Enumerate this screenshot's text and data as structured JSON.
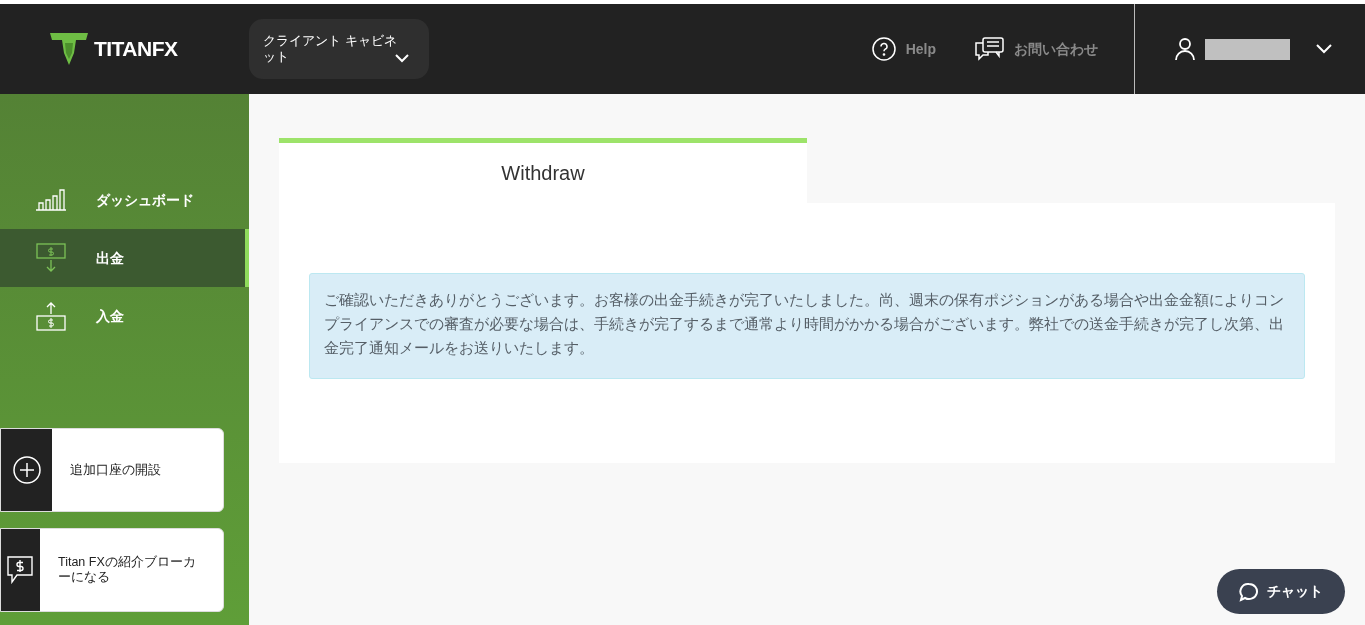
{
  "header": {
    "logo": "TITANFX",
    "cabinet_menu": "クライアント キャビネット",
    "help": "Help",
    "contact": "お問い合わせ"
  },
  "sidebar": {
    "items": [
      {
        "label": "ダッシュボード",
        "kind": "chart",
        "selected": false
      },
      {
        "label": "出金",
        "kind": "withdraw",
        "selected": true
      },
      {
        "label": "入金",
        "kind": "deposit",
        "selected": false
      }
    ],
    "cards": [
      {
        "label": "追加口座の開設",
        "kind": "plus"
      },
      {
        "label": "Titan FXの紹介ブローカーになる",
        "kind": "dollar-chat"
      }
    ]
  },
  "main": {
    "tab": "Withdraw",
    "message": "ご確認いただきありがとうございます。お客様の出金手続きが完了いたしました。尚、週末の保有ポジションがある場合や出金金額によりコンプライアンスでの審査が必要な場合は、手続きが完了するまで通常より時間がかかる場合がございます。弊社での送金手続きが完了し次第、出金完了通知メールをお送りいたします。"
  },
  "chat_button": "チャット"
}
